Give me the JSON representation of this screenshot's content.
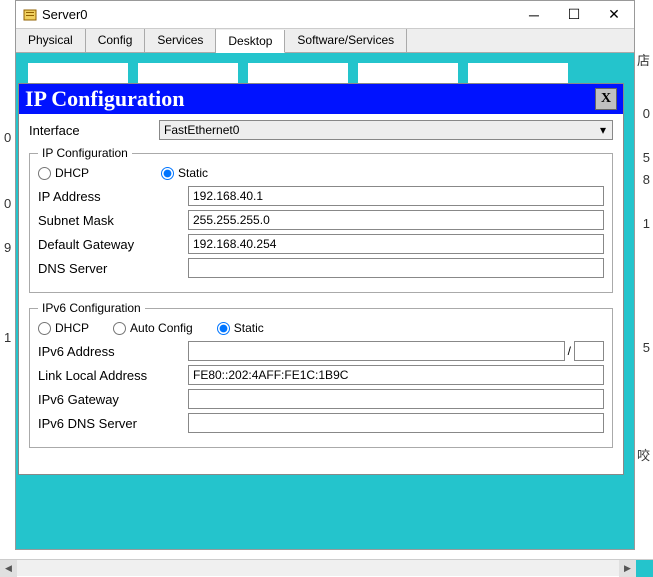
{
  "window": {
    "title": "Server0"
  },
  "tabs": [
    "Physical",
    "Config",
    "Services",
    "Desktop",
    "Software/Services"
  ],
  "active_tab": "Desktop",
  "dialog": {
    "title": "IP Configuration",
    "close": "X",
    "interface_label": "Interface",
    "interface_value": "FastEthernet0",
    "ipcfg": {
      "legend": "IP Configuration",
      "dhcp": "DHCP",
      "static": "Static",
      "ip_label": "IP Address",
      "ip_value": "192.168.40.1",
      "mask_label": "Subnet Mask",
      "mask_value": "255.255.255.0",
      "gw_label": "Default Gateway",
      "gw_value": "192.168.40.254",
      "dns_label": "DNS Server",
      "dns_value": ""
    },
    "ipv6": {
      "legend": "IPv6 Configuration",
      "dhcp": "DHCP",
      "auto": "Auto Config",
      "static": "Static",
      "addr_label": "IPv6 Address",
      "addr_value": "",
      "prefix_value": "",
      "ll_label": "Link Local Address",
      "ll_value": "FE80::202:4AFF:FE1C:1B9C",
      "gw_label": "IPv6 Gateway",
      "gw_value": "",
      "dns_label": "IPv6 DNS Server",
      "dns_value": ""
    }
  }
}
